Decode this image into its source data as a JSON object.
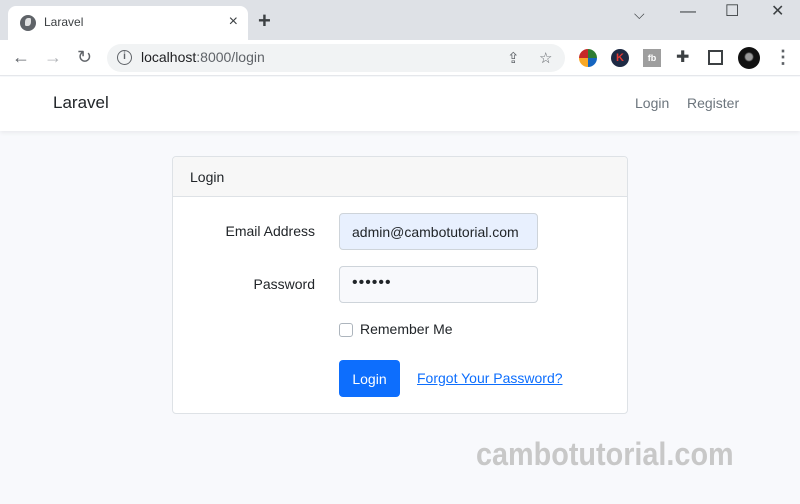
{
  "browser": {
    "tab_title": "Laravel",
    "tab_close": "×",
    "new_tab": "+",
    "window_controls": {
      "tab_search": "⌵",
      "minimize": "—",
      "maximize": "☐",
      "close": "✕"
    },
    "nav": {
      "back": "←",
      "forward": "→",
      "reload": "↻"
    },
    "url_host": "localhost",
    "url_rest": ":8000/login",
    "info_icon": "i",
    "share": "⇪",
    "bookmark": "☆",
    "extensions": [
      "idm-icon",
      "k-extension-icon",
      "fb-extension-icon",
      "puzzle-icon",
      "side-panel-icon",
      "profile-avatar"
    ],
    "menu": "⋮"
  },
  "navbar": {
    "brand": "Laravel",
    "links": [
      "Login",
      "Register"
    ]
  },
  "card": {
    "header": "Login",
    "email_label": "Email Address",
    "email_value": "admin@cambotutorial.com",
    "password_label": "Password",
    "password_value": "••••••",
    "remember_label": "Remember Me",
    "remember_checked": false,
    "submit_label": "Login",
    "forgot_link": "Forgot Your Password?"
  },
  "colors": {
    "primary": "#0d6efd",
    "autofill": "#e8f0fe"
  },
  "watermark": "cambotutorial.com"
}
